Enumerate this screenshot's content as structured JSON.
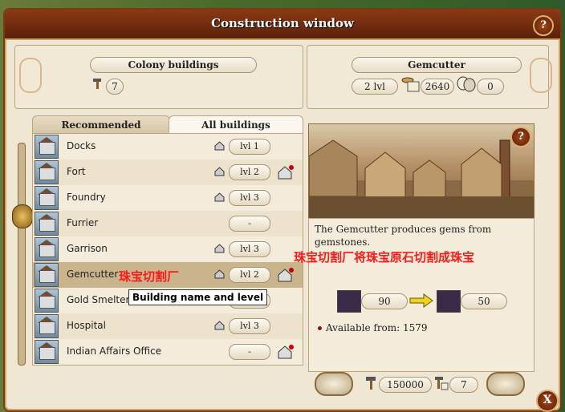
{
  "window": {
    "title": "Construction window",
    "help_label": "?",
    "close_label": "X"
  },
  "colony": {
    "header": "Colony buildings",
    "builders": "7"
  },
  "selected": {
    "header": "Gemcutter",
    "level": "2 lvl",
    "cost": "2640",
    "entertainment": "0"
  },
  "tabs": [
    {
      "label": "Recommended"
    },
    {
      "label": "All buildings"
    }
  ],
  "buildings": [
    {
      "name": "Docks",
      "level": "lvl 1"
    },
    {
      "name": "Fort",
      "level": "lvl 2"
    },
    {
      "name": "Foundry",
      "level": "lvl 3"
    },
    {
      "name": "Furrier",
      "level": "-"
    },
    {
      "name": "Garrison",
      "level": "lvl 3"
    },
    {
      "name": "Gemcutter",
      "level": "lvl 2"
    },
    {
      "name": "Gold Smelter",
      "level": "lvl 3"
    },
    {
      "name": "Hospital",
      "level": "lvl 3"
    },
    {
      "name": "Indian Affairs Office",
      "level": "-"
    }
  ],
  "tooltip": "Building name and level",
  "annotations": {
    "building_cn": "珠宝切割厂",
    "desc_cn": "珠宝切割厂将珠宝原石切割成珠宝"
  },
  "description": "The Gemcutter produces gems from gemstones.",
  "production": {
    "input": "90",
    "output": "50"
  },
  "available_from": "Available from: 1579",
  "footer": {
    "cost": "150000",
    "builders": "7"
  },
  "colors": {
    "title_bar": "#6e2a0e",
    "annotation": "#ff1a1a",
    "selected_row": "#c9b48c"
  }
}
